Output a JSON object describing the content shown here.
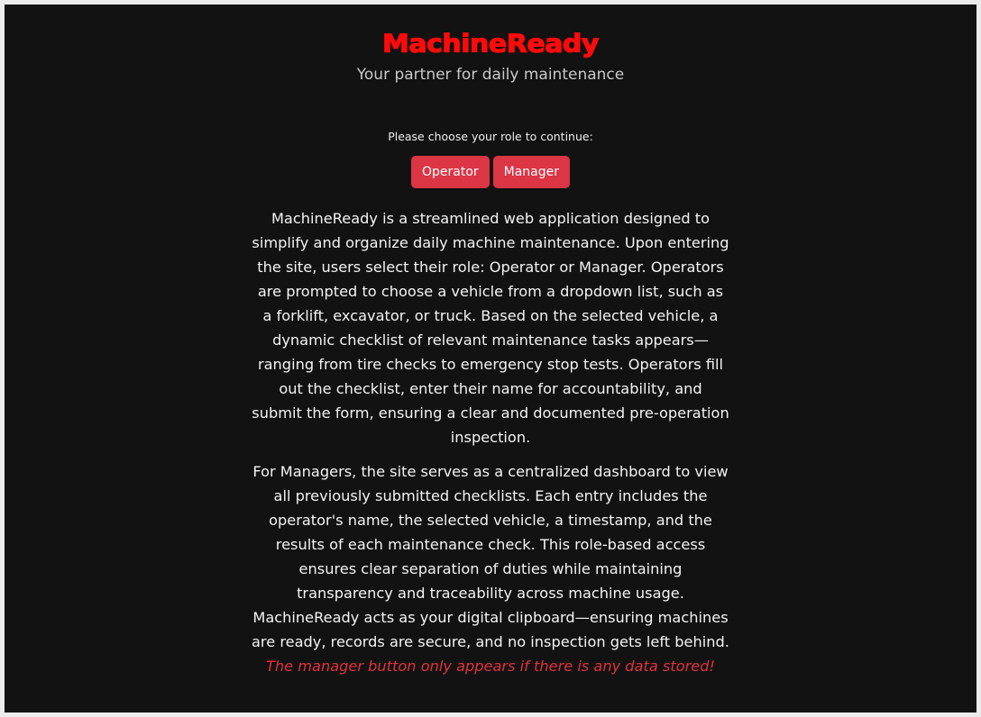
{
  "app": {
    "title": "MachineReady",
    "subtitle": "Your partner for daily maintenance"
  },
  "role_select": {
    "prompt": "Please choose your role to continue:",
    "operator_label": "Operator",
    "manager_label": "Manager"
  },
  "description": {
    "paragraph1": "MachineReady is a streamlined web application designed to simplify and organize daily machine maintenance. Upon entering the site, users select their role: Operator or Manager. Operators are prompted to choose a vehicle from a dropdown list, such as a forklift, excavator, or truck. Based on the selected vehicle, a dynamic checklist of relevant maintenance tasks appears—ranging from tire checks to emergency stop tests. Operators fill out the checklist, enter their name for accountability, and submit the form, ensuring a clear and documented pre-operation inspection.",
    "paragraph2": "For Managers, the site serves as a centralized dashboard to view all previously submitted checklists. Each entry includes the operator's name, the selected vehicle, a timestamp, and the results of each maintenance check. This role-based access ensures clear separation of duties while maintaining transparency and traceability across machine usage. MachineReady acts as your digital clipboard—ensuring machines are ready, records are secure, and no inspection gets left behind.",
    "note": "The manager button only appears if there is any data stored!"
  },
  "colors": {
    "background": "#121212",
    "title": "#ff0a0a",
    "button": "#dc3545",
    "note": "#e1323e"
  }
}
